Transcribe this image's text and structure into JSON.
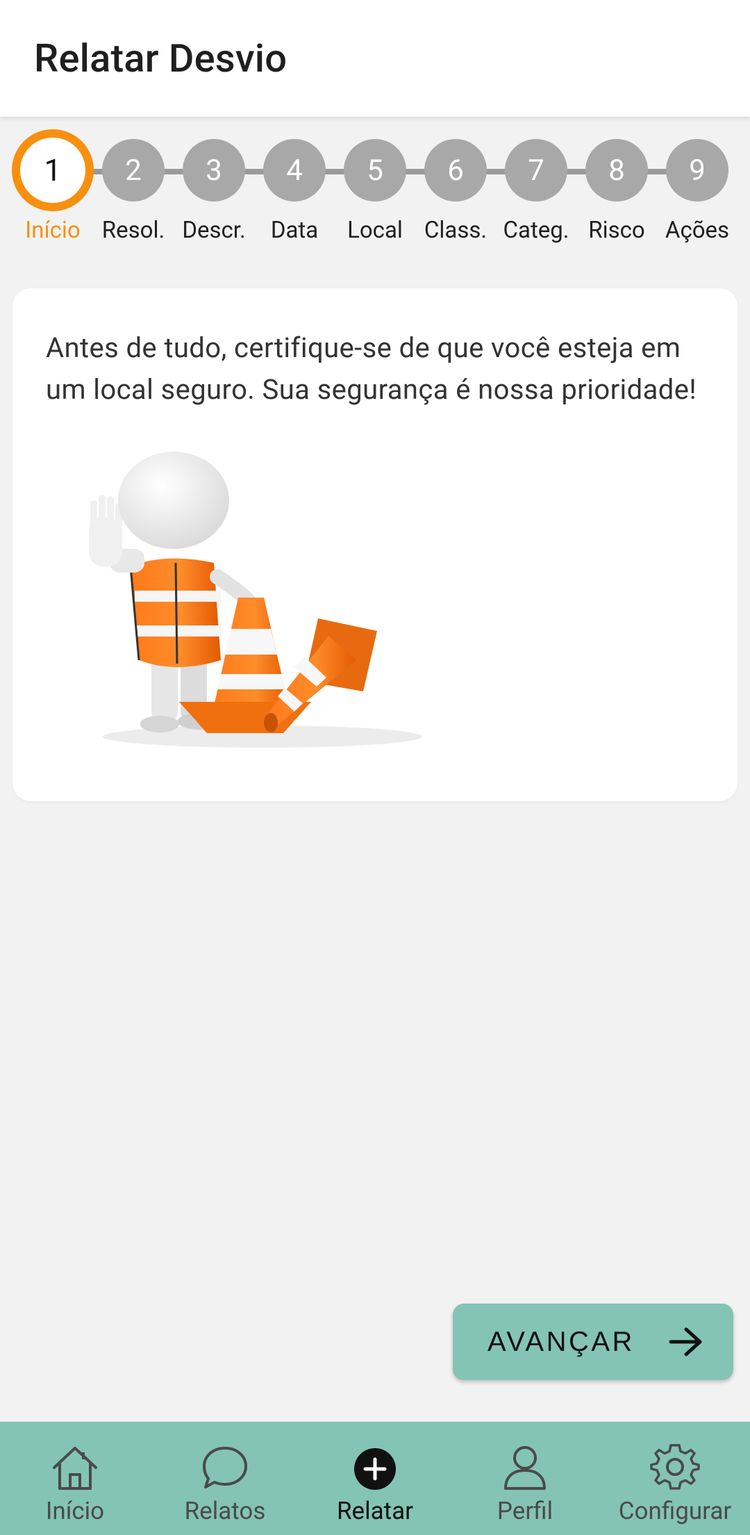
{
  "header": {
    "title": "Relatar Desvio"
  },
  "stepper": {
    "current": 1,
    "steps": [
      {
        "number": "1",
        "label": "Início"
      },
      {
        "number": "2",
        "label": "Resol."
      },
      {
        "number": "3",
        "label": "Descr."
      },
      {
        "number": "4",
        "label": "Data"
      },
      {
        "number": "5",
        "label": "Local"
      },
      {
        "number": "6",
        "label": "Class."
      },
      {
        "number": "7",
        "label": "Categ."
      },
      {
        "number": "8",
        "label": "Risco"
      },
      {
        "number": "9",
        "label": "Ações"
      }
    ]
  },
  "card": {
    "message": "Antes de tudo, certifique-se de que você esteja em um local seguro. Sua segurança é nossa prioridade!",
    "illustration": "safety-worker-with-cones-illustration"
  },
  "actions": {
    "advance_label": "AVANÇAR",
    "advance_icon": "arrow-right-icon"
  },
  "bottom_nav": {
    "items": [
      {
        "label": "Início",
        "icon": "home-icon"
      },
      {
        "label": "Relatos",
        "icon": "chat-bubble-icon"
      },
      {
        "label": "Relatar",
        "icon": "add-circle-icon",
        "active": true
      },
      {
        "label": "Perfil",
        "icon": "person-icon"
      },
      {
        "label": "Configurar",
        "icon": "gear-icon"
      }
    ]
  },
  "colors": {
    "accent": "#f7900f",
    "teal": "#84c4b4",
    "inactive_step": "#a8a8a8",
    "background": "#f2f2f2"
  }
}
